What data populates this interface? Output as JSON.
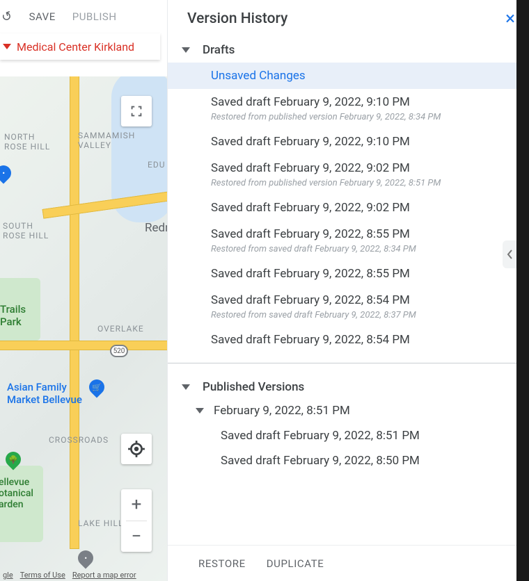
{
  "toolbar": {
    "save_label": "SAVE",
    "publish_label": "PUBLISH"
  },
  "context_bar": {
    "title": "Medical Center Kirkland"
  },
  "map": {
    "labels": {
      "north_rose_hill": "NORTH\nROSE HILL",
      "sammamish_valley": "SAMMAMISH\nVALLEY",
      "edu": "EDU",
      "south_rose_hill": "SOUTH\nROSE HILL",
      "redm": "Redm",
      "trails_park": "Trails\nPark",
      "overlake": "OVERLAKE",
      "crossroads": "CROSSROADS",
      "lake_hill": "LAKE HILL",
      "bellevue_garden": "ellevue\notanical\narden",
      "asian_market": "Asian Family\nMarket Bellevue",
      "route_520": "520"
    },
    "footer": {
      "gle": "gle",
      "terms": "Terms of Use",
      "report": "Report a map error"
    }
  },
  "version_panel": {
    "title": "Version History",
    "sections": {
      "drafts_label": "Drafts",
      "published_label": "Published Versions"
    },
    "drafts": [
      {
        "label": "Unsaved Changes",
        "selected": true
      },
      {
        "label": "Saved draft February 9, 2022, 9:10 PM",
        "sub": "Restored from published version February 9, 2022, 8:34 PM"
      },
      {
        "label": "Saved draft February 9, 2022, 9:10 PM"
      },
      {
        "label": "Saved draft February 9, 2022, 9:02 PM",
        "sub": "Restored from published version February 9, 2022, 8:51 PM"
      },
      {
        "label": "Saved draft February 9, 2022, 9:02 PM"
      },
      {
        "label": "Saved draft February 9, 2022, 8:55 PM",
        "sub": "Restored from saved draft February 9, 2022, 8:34 PM"
      },
      {
        "label": "Saved draft February 9, 2022, 8:55 PM"
      },
      {
        "label": "Saved draft February 9, 2022, 8:54 PM",
        "sub": "Restored from saved draft February 9, 2022, 8:37 PM"
      },
      {
        "label": "Saved draft February 9, 2022, 8:54 PM"
      }
    ],
    "published_group": {
      "date_label": "February 9, 2022, 8:51 PM",
      "items": [
        {
          "label": "Saved draft February 9, 2022, 8:51 PM"
        },
        {
          "label": "Saved draft February 9, 2022, 8:50 PM"
        }
      ]
    },
    "actions": {
      "restore": "RESTORE",
      "duplicate": "DUPLICATE"
    }
  }
}
